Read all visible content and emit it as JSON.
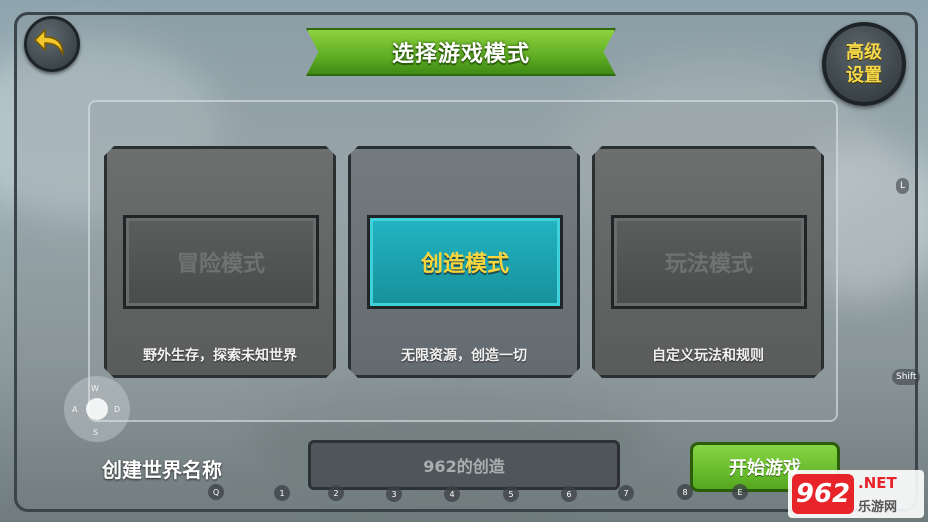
{
  "header": {
    "title": "选择游戏模式",
    "advanced_settings": "高级设置",
    "back_icon": "back-arrow-icon"
  },
  "modes": [
    {
      "label": "冒险模式",
      "description": "野外生存，探索未知世界",
      "selected": false
    },
    {
      "label": "创造模式",
      "description": "无限资源，创造一切",
      "selected": true
    },
    {
      "label": "玩法模式",
      "description": "自定义玩法和规则",
      "selected": false
    }
  ],
  "joystick": {
    "up": "W",
    "left": "A",
    "right": "D",
    "down": "S"
  },
  "footer": {
    "world_name_label": "创建世界名称",
    "world_name_value": "962的创造",
    "start_button": "开始游戏"
  },
  "key_hints": [
    "Q",
    "1",
    "2",
    "3",
    "4",
    "5",
    "6",
    "7",
    "8",
    "E"
  ],
  "side_hints": {
    "l": "L",
    "shift": "Shift"
  },
  "watermark": {
    "badge": "962",
    "net": ".NET",
    "cn": "乐游网"
  },
  "colors": {
    "title_green": "#5fae24",
    "selected_teal": "#16909b",
    "selected_text": "#f7d53c",
    "start_green": "#55a81f"
  }
}
